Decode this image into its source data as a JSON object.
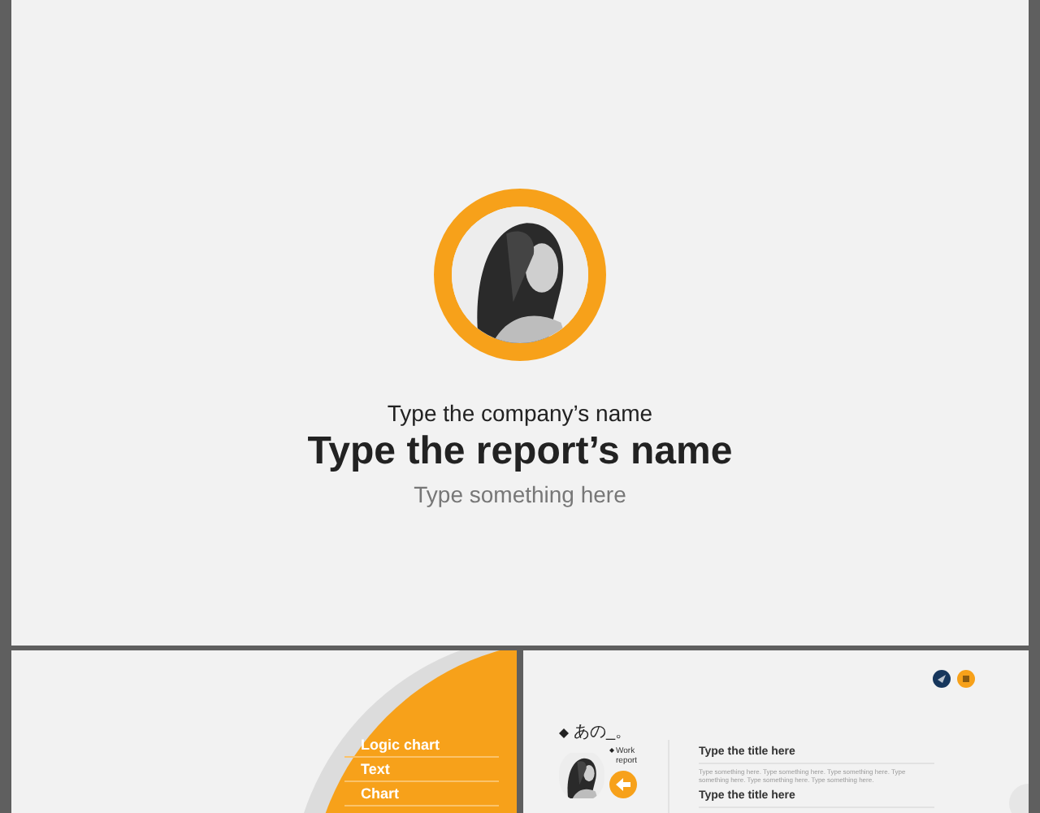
{
  "title_slide": {
    "company": "Type the company’s name",
    "report": "Type the report’s name",
    "subtitle": "Type something here"
  },
  "menu_slide": {
    "items": [
      {
        "label": "Logic chart"
      },
      {
        "label": "Text"
      },
      {
        "label": "Chart"
      }
    ]
  },
  "content_slide": {
    "heading": "あの_。",
    "side_label": "Work report",
    "sections": [
      {
        "title": "Type the title here",
        "body": "Type something here. Type something here. Type something here. Type something here. Type something here. Type something here."
      },
      {
        "title": "Type the title here"
      }
    ]
  }
}
